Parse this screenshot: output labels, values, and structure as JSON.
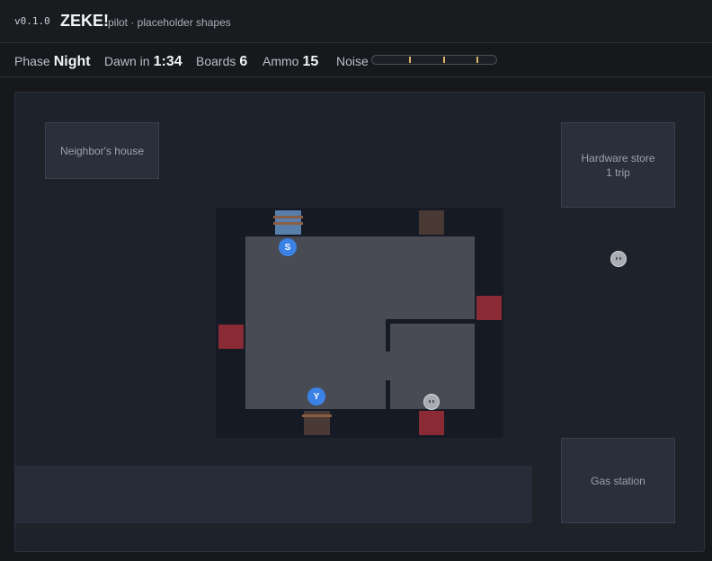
{
  "header": {
    "version": "v0.1.0",
    "title": "ZEKE!",
    "subtitle": "pilot · placeholder shapes"
  },
  "status": {
    "phase_label": "Phase",
    "phase_value": "Night",
    "dawn_label": "Dawn in",
    "dawn_value": "1:34",
    "boards_label": "Boards",
    "boards_value": "6",
    "ammo_label": "Ammo",
    "ammo_value": "15",
    "noise_label": "Noise",
    "noise_level": 0,
    "noise_thresholds": [
      0.3,
      0.57,
      0.84
    ]
  },
  "map": {
    "landmarks": {
      "neighbor": "Neighbor's house",
      "hardware_line1": "Hardware store",
      "hardware_line2": "1 trip",
      "gas": "Gas station"
    },
    "tokens": {
      "survivor": "S",
      "you": "Y"
    }
  },
  "colors": {
    "player": "#3b82e6",
    "boarded_window": "#5a7eaa",
    "breached_window": "#8a2a34",
    "noise": "#d8b56a"
  }
}
